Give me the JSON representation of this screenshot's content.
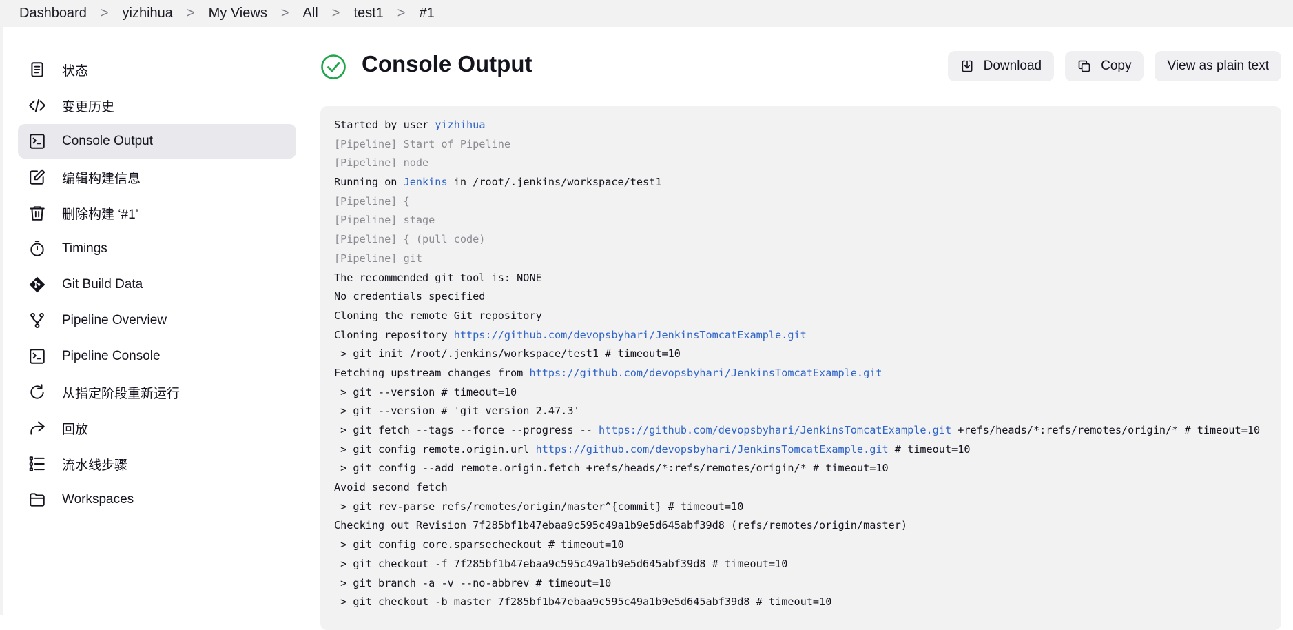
{
  "breadcrumb": [
    "Dashboard",
    "yizhihua",
    "My Views",
    "All",
    "test1",
    "#1"
  ],
  "sidebar": {
    "items": [
      {
        "label": "状态",
        "icon": "document-icon"
      },
      {
        "label": "变更历史",
        "icon": "code-icon"
      },
      {
        "label": "Console Output",
        "icon": "terminal-icon",
        "active": true
      },
      {
        "label": "编辑构建信息",
        "icon": "edit-icon"
      },
      {
        "label": "删除构建 ‘#1’",
        "icon": "trash-icon"
      },
      {
        "label": "Timings",
        "icon": "stopwatch-icon"
      },
      {
        "label": "Git Build Data",
        "icon": "git-icon"
      },
      {
        "label": "Pipeline Overview",
        "icon": "branch-icon"
      },
      {
        "label": "Pipeline Console",
        "icon": "terminal-icon"
      },
      {
        "label": "从指定阶段重新运行",
        "icon": "redo-icon"
      },
      {
        "label": "回放",
        "icon": "replay-icon"
      },
      {
        "label": "流水线步骤",
        "icon": "list-icon"
      },
      {
        "label": "Workspaces",
        "icon": "folder-icon"
      }
    ]
  },
  "main": {
    "title": "Console Output",
    "status_color": "#1ea64b",
    "actions": {
      "download": "Download",
      "copy": "Copy",
      "plain": "View as plain text"
    },
    "console": {
      "link_color": "#2f64c9",
      "lines": [
        {
          "type": "normal",
          "parts": [
            {
              "t": "Started by user "
            },
            {
              "t": "yizhihua",
              "link": true
            }
          ]
        },
        {
          "type": "muted",
          "parts": [
            {
              "t": "[Pipeline] Start of Pipeline"
            }
          ]
        },
        {
          "type": "muted",
          "parts": [
            {
              "t": "[Pipeline] node"
            }
          ]
        },
        {
          "type": "normal",
          "parts": [
            {
              "t": "Running on "
            },
            {
              "t": "Jenkins",
              "link": true
            },
            {
              "t": " in /root/.jenkins/workspace/test1"
            }
          ]
        },
        {
          "type": "muted",
          "parts": [
            {
              "t": "[Pipeline] {"
            }
          ]
        },
        {
          "type": "muted",
          "parts": [
            {
              "t": "[Pipeline] stage"
            }
          ]
        },
        {
          "type": "muted",
          "parts": [
            {
              "t": "[Pipeline] { (pull code)"
            }
          ]
        },
        {
          "type": "muted",
          "parts": [
            {
              "t": "[Pipeline] git"
            }
          ]
        },
        {
          "type": "normal",
          "parts": [
            {
              "t": "The recommended git tool is: NONE"
            }
          ]
        },
        {
          "type": "normal",
          "parts": [
            {
              "t": "No credentials specified"
            }
          ]
        },
        {
          "type": "normal",
          "parts": [
            {
              "t": "Cloning the remote Git repository"
            }
          ]
        },
        {
          "type": "normal",
          "parts": [
            {
              "t": "Cloning repository "
            },
            {
              "t": "https://github.com/devopsbyhari/JenkinsTomcatExample.git",
              "link": true
            }
          ]
        },
        {
          "type": "normal",
          "parts": [
            {
              "t": " > git init /root/.jenkins/workspace/test1 # timeout=10"
            }
          ]
        },
        {
          "type": "normal",
          "parts": [
            {
              "t": "Fetching upstream changes from "
            },
            {
              "t": "https://github.com/devopsbyhari/JenkinsTomcatExample.git",
              "link": true
            }
          ]
        },
        {
          "type": "normal",
          "parts": [
            {
              "t": " > git --version # timeout=10"
            }
          ]
        },
        {
          "type": "normal",
          "parts": [
            {
              "t": " > git --version # 'git version 2.47.3'"
            }
          ]
        },
        {
          "type": "normal",
          "parts": [
            {
              "t": " > git fetch --tags --force --progress -- "
            },
            {
              "t": "https://github.com/devopsbyhari/JenkinsTomcatExample.git",
              "link": true
            },
            {
              "t": " +refs/heads/*:refs/remotes/origin/* # timeout=10"
            }
          ]
        },
        {
          "type": "normal",
          "parts": [
            {
              "t": " > git config remote.origin.url "
            },
            {
              "t": "https://github.com/devopsbyhari/JenkinsTomcatExample.git",
              "link": true
            },
            {
              "t": " # timeout=10"
            }
          ]
        },
        {
          "type": "normal",
          "parts": [
            {
              "t": " > git config --add remote.origin.fetch +refs/heads/*:refs/remotes/origin/* # timeout=10"
            }
          ]
        },
        {
          "type": "normal",
          "parts": [
            {
              "t": "Avoid second fetch"
            }
          ]
        },
        {
          "type": "normal",
          "parts": [
            {
              "t": " > git rev-parse refs/remotes/origin/master^{commit} # timeout=10"
            }
          ]
        },
        {
          "type": "normal",
          "parts": [
            {
              "t": "Checking out Revision 7f285bf1b47ebaa9c595c49a1b9e5d645abf39d8 (refs/remotes/origin/master)"
            }
          ]
        },
        {
          "type": "normal",
          "parts": [
            {
              "t": " > git config core.sparsecheckout # timeout=10"
            }
          ]
        },
        {
          "type": "normal",
          "parts": [
            {
              "t": " > git checkout -f 7f285bf1b47ebaa9c595c49a1b9e5d645abf39d8 # timeout=10"
            }
          ]
        },
        {
          "type": "normal",
          "parts": [
            {
              "t": " > git branch -a -v --no-abbrev # timeout=10"
            }
          ]
        },
        {
          "type": "normal",
          "parts": [
            {
              "t": " > git checkout -b master 7f285bf1b47ebaa9c595c49a1b9e5d645abf39d8 # timeout=10"
            }
          ]
        }
      ]
    }
  }
}
